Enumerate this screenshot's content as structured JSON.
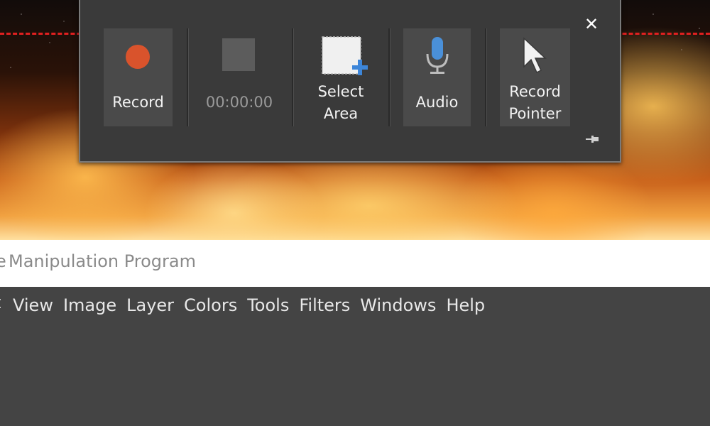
{
  "background": {
    "window_title_fragment": "Manipulation Program",
    "title_edge_glyph": "e"
  },
  "menu": {
    "edge_glyph": "t",
    "items": [
      "View",
      "Image",
      "Layer",
      "Colors",
      "Tools",
      "Filters",
      "Windows",
      "Help"
    ]
  },
  "toolbar": {
    "record_label": "Record",
    "timer": "00:00:00",
    "select_area_line1": "Select",
    "select_area_line2": "Area",
    "audio_label": "Audio",
    "record_pointer_line1": "Record",
    "record_pointer_line2": "Pointer",
    "close_glyph": "✕"
  },
  "colors": {
    "record_dot": "#d9532c",
    "audio_mic": "#4a90d9",
    "selection_border": "#e02020",
    "toolbar_bg": "#3a3a3a"
  },
  "icons": {
    "record": "record-dot-icon",
    "stop": "stop-square-icon",
    "select_area": "select-area-icon",
    "audio": "microphone-icon",
    "pointer": "cursor-arrow-icon",
    "close": "close-icon",
    "pin": "pin-icon"
  }
}
